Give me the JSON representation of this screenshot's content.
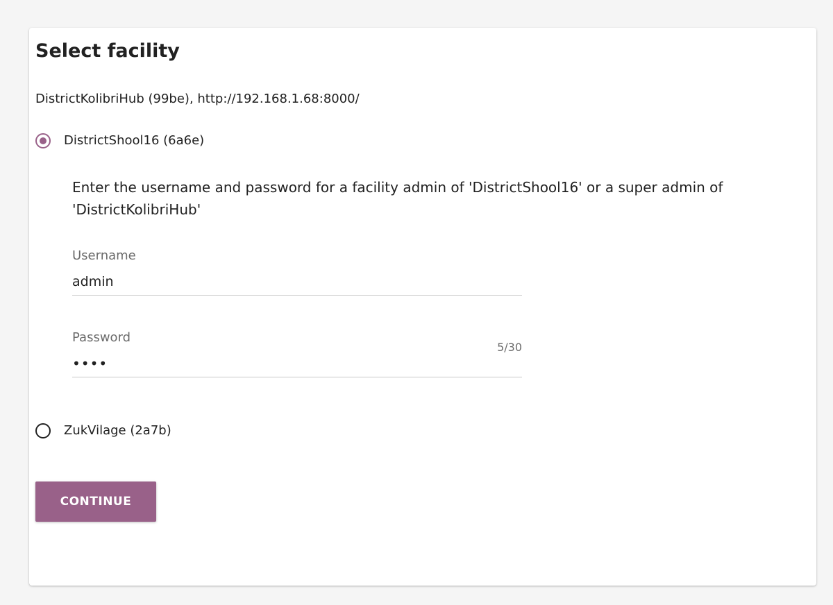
{
  "page": {
    "title": "Select facility",
    "device_info": "DistrictKolibriHub (99be), http://192.168.1.68:8000/"
  },
  "facilities": [
    {
      "label": "DistrictShool16 (6a6e)",
      "selected": true
    },
    {
      "label": "ZukVilage (2a7b)",
      "selected": false
    }
  ],
  "credentials": {
    "instruction": "Enter the username and password for a facility admin of 'DistrictShool16' or a super admin of 'DistrictKolibriHub'",
    "username_label": "Username",
    "username_value": "admin",
    "username_counter": "5/30",
    "password_label": "Password",
    "password_value": "••••"
  },
  "actions": {
    "continue_label": "CONTINUE"
  },
  "colors": {
    "accent": "#996189",
    "background": "#f5f5f5",
    "card": "#ffffff",
    "text": "#212121",
    "muted": "#6b6b6b"
  }
}
